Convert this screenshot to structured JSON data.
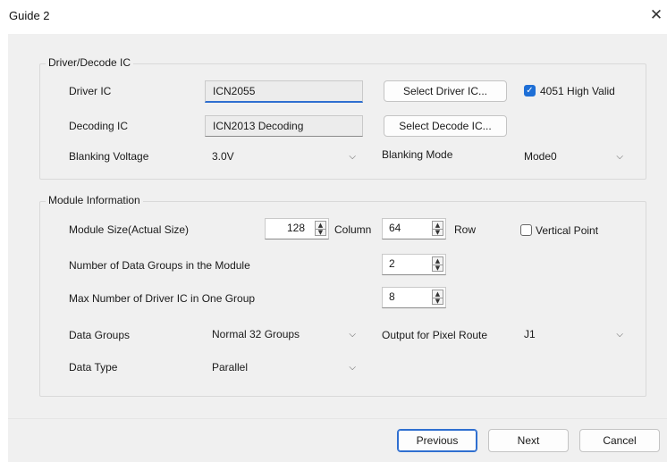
{
  "window": {
    "title": "Guide 2",
    "close_icon": "close-icon"
  },
  "driver_group": {
    "legend": "Driver/Decode IC",
    "driver_ic": {
      "label": "Driver IC",
      "value": "ICN2055",
      "button": "Select Driver IC..."
    },
    "high_valid": {
      "label": "4051 High Valid",
      "checked": true
    },
    "decoding_ic": {
      "label": "Decoding IC",
      "value": "ICN2013 Decoding",
      "button": "Select Decode IC..."
    },
    "blanking_voltage": {
      "label": "Blanking Voltage",
      "value": "3.0V"
    },
    "blanking_mode": {
      "label": "Blanking Mode",
      "value": "Mode0"
    }
  },
  "module_group": {
    "legend": "Module Information",
    "module_size": {
      "label": "Module Size(Actual Size)",
      "columns": "128",
      "column_label": "Column",
      "rows": "64",
      "row_label": "Row"
    },
    "vertical_point": {
      "label": "Vertical Point",
      "checked": false
    },
    "data_groups_count": {
      "label": "Number of Data Groups in the Module",
      "value": "2"
    },
    "max_driver_ic": {
      "label": "Max Number of Driver IC in One Group",
      "value": "8"
    },
    "data_groups": {
      "label": "Data Groups",
      "value": "Normal 32 Groups"
    },
    "pixel_route": {
      "label": "Output for Pixel Route",
      "value": "J1"
    },
    "data_type": {
      "label": "Data Type",
      "value": "Parallel"
    }
  },
  "footer": {
    "previous": "Previous",
    "next": "Next",
    "cancel": "Cancel"
  },
  "colors": {
    "accent": "#2f6fd0",
    "background": "#f0f0f0"
  }
}
